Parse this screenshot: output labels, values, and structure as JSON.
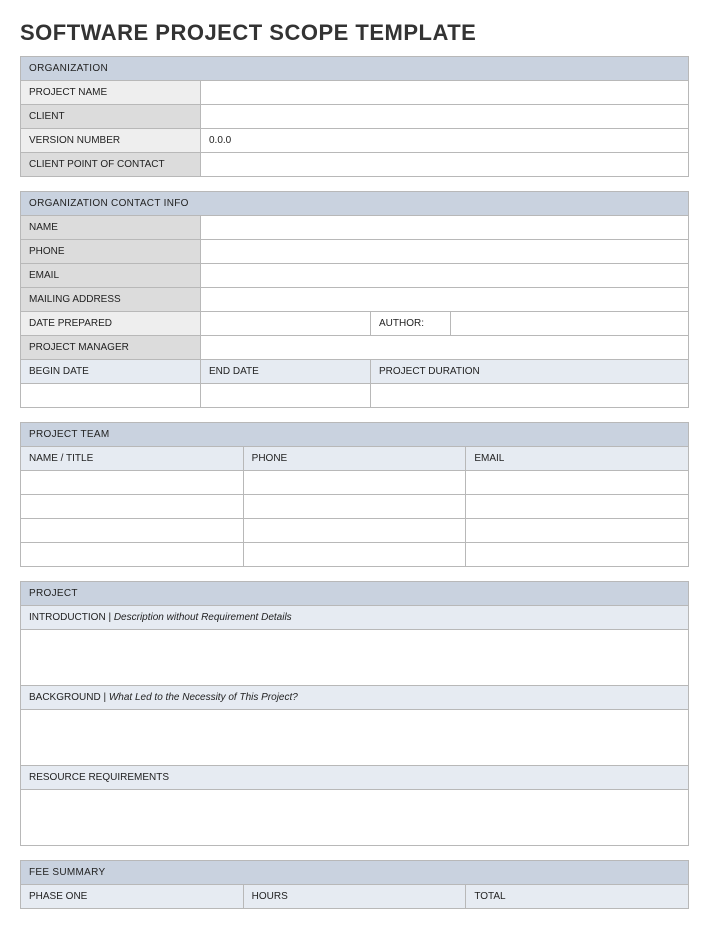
{
  "title": "SOFTWARE PROJECT SCOPE TEMPLATE",
  "organization": {
    "header": "ORGANIZATION",
    "projectNameLabel": "PROJECT NAME",
    "projectName": "",
    "clientLabel": "CLIENT",
    "client": "",
    "versionNumberLabel": "VERSION NUMBER",
    "versionNumber": "0.0.0",
    "clientPocLabel": "CLIENT POINT OF CONTACT",
    "clientPoc": ""
  },
  "contact": {
    "header": "ORGANIZATION CONTACT INFO",
    "nameLabel": "NAME",
    "name": "",
    "phoneLabel": "PHONE",
    "phone": "",
    "emailLabel": "EMAIL",
    "email": "",
    "mailingLabel": "MAILING ADDRESS",
    "mailing": "",
    "datePreparedLabel": "DATE PREPARED",
    "datePrepared": "",
    "authorLabel": "AUTHOR:",
    "author": "",
    "projectManagerLabel": "PROJECT MANAGER",
    "projectManager": "",
    "beginDateLabel": "BEGIN DATE",
    "endDateLabel": "END DATE",
    "projectDurationLabel": "PROJECT DURATION",
    "beginDate": "",
    "endDate": "",
    "projectDuration": ""
  },
  "team": {
    "header": "PROJECT TEAM",
    "colName": "NAME / TITLE",
    "colPhone": "PHONE",
    "colEmail": "EMAIL",
    "rows": [
      {
        "name": "",
        "phone": "",
        "email": ""
      },
      {
        "name": "",
        "phone": "",
        "email": ""
      },
      {
        "name": "",
        "phone": "",
        "email": ""
      },
      {
        "name": "",
        "phone": "",
        "email": ""
      }
    ]
  },
  "project": {
    "header": "PROJECT",
    "introLabel": "INTRODUCTION  | ",
    "introHint": "Description without Requirement Details",
    "introText": "",
    "backgroundLabel": "BACKGROUND  | ",
    "backgroundHint": "What Led to the Necessity of This Project?",
    "backgroundText": "",
    "resourceLabel": "RESOURCE REQUIREMENTS",
    "resourceText": ""
  },
  "fee": {
    "header": "FEE SUMMARY",
    "colPhase": "PHASE ONE",
    "colHours": "HOURS",
    "colTotal": "TOTAL"
  }
}
